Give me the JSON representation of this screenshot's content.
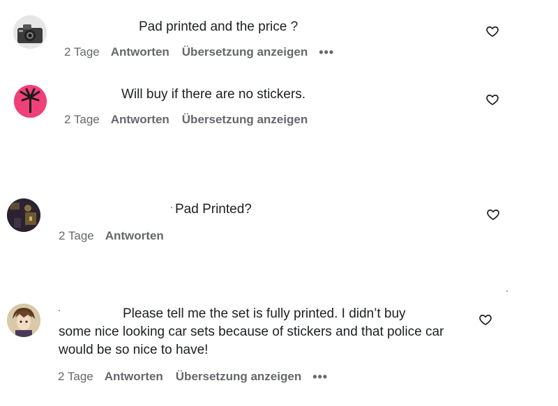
{
  "comments": [
    {
      "text": "Pad printed and the price ?",
      "time": "2 Tage",
      "reply": "Antworten",
      "translate": "Übersetzung anzeigen",
      "more": "•••",
      "avatar_icon": "camera-avatar"
    },
    {
      "text": "Will buy if there are no stickers.",
      "time": "2 Tage",
      "reply": "Antworten",
      "translate": "Übersetzung anzeigen",
      "avatar_icon": "palm-tree-avatar",
      "avatar_color": "#f0407a"
    },
    {
      "text": "Pad Printed?",
      "time": "2 Tage",
      "reply": "Antworten",
      "avatar_icon": "dark-photo-avatar"
    },
    {
      "text_line1": "Please tell me the set is fully printed. I didn’t buy",
      "text_rest": "some nice looking car sets because of stickers and that police car would be so nice to have!",
      "time": "2 Tage",
      "reply": "Antworten",
      "translate": "Übersetzung anzeigen",
      "more": "•••",
      "avatar_icon": "anime-character-avatar"
    }
  ],
  "icons": {
    "like": "heart-outline-icon"
  }
}
